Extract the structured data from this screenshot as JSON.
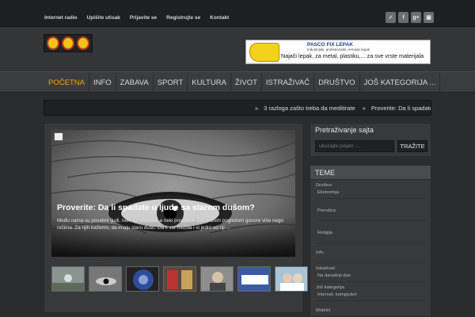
{
  "topbar": {
    "links": [
      "Internet radio",
      "Upišite utisak",
      "Prijavite se",
      "Registrujte se",
      "Kontakt"
    ],
    "social_icons": [
      "twitter-icon",
      "facebook-icon",
      "google-plus-icon",
      "youtube-icon"
    ]
  },
  "ad": {
    "title": "PASCO FIX LEPAK",
    "subtitle": "Industrijski, profesionalni, remado lepak",
    "text": "Najači lepak, za metal, plastiku,...  za sve vrste materijala"
  },
  "nav": {
    "items": [
      "POČETNA",
      "INFO",
      "ZABAVA",
      "SPORT",
      "KULTURA",
      "ŽIVOT",
      "ISTRAŽIVAČ",
      "DRUŠTVO",
      "JOŠ KATEGORIJA ..."
    ],
    "active": "POČETNA"
  },
  "ticker": {
    "items": [
      "3 razloga zašto treba da meditirate",
      "Proverite: Da li spadate u"
    ]
  },
  "slider": {
    "title": "Proverite: Da li spadate u ljude sa starom dušom?",
    "excerpt": "Među nama su posebni ljudi, neki su otvoreni, a neki povučeni. Oni jednim pogledom govore više nego rečima. Za njih kažemo, da imaju staru dušu. Da li ste možda i vi jedni od nji ..."
  },
  "search": {
    "title": "Pretraživanje sajta",
    "placeholder": "ukucajte pojam ...",
    "button": "TRAŽITE"
  },
  "teme": {
    "title": "TEME",
    "items": [
      {
        "parent": "Društvo",
        "child": "Ekonomija"
      },
      {
        "parent": "",
        "child": "Porodica"
      },
      {
        "parent": "",
        "child": "Religija"
      },
      {
        "parent": "Info",
        "child": ""
      },
      {
        "parent": "Istraživač",
        "child": "Na današnji dan"
      },
      {
        "parent": "Još kategorija",
        "child": "Internet, kompjuteri"
      },
      {
        "parent": "Mobilni",
        "child": ""
      }
    ]
  }
}
